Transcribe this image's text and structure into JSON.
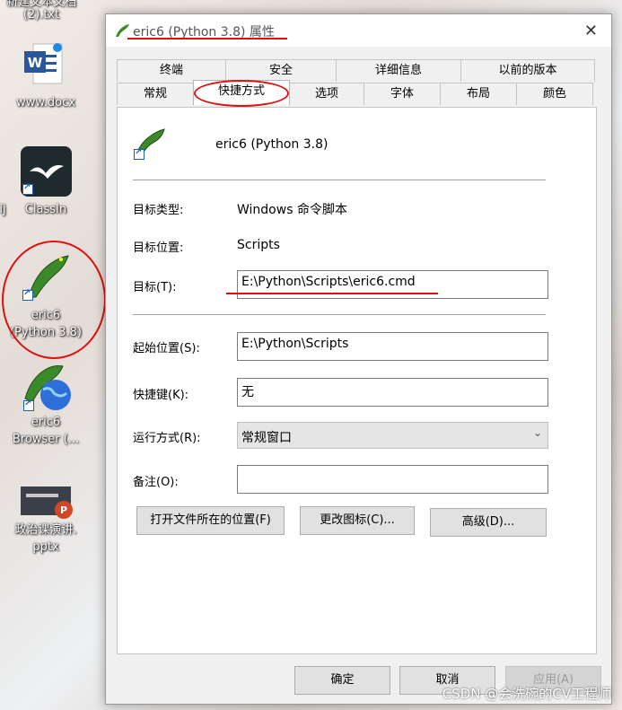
{
  "desktop": {
    "items": [
      {
        "label_line1": "新建文本文档",
        "label_line2": "(2).txt"
      },
      {
        "label_line1": "www.docx",
        "label_line2": ""
      },
      {
        "label_line1": "ClassIn",
        "label_line2": ""
      },
      {
        "label_line1": "eric6",
        "label_line2": "(Python 3.8)"
      },
      {
        "label_line1": "eric6",
        "label_line2": "Browser (..."
      },
      {
        "label_line1": "政治课演讲.",
        "label_line2": "pptx"
      }
    ],
    "left_edge_label": "ij",
    "watermark": "CSDN @会洗碗的CV工程师"
  },
  "dialog": {
    "title": "eric6 (Python 3.8) 属性",
    "close_glyph": "✕",
    "tabs_row1": [
      "终端",
      "安全",
      "详细信息",
      "以前的版本"
    ],
    "tabs_row2": [
      "常规",
      "快捷方式",
      "选项",
      "字体",
      "布局",
      "颜色"
    ],
    "active_tab": "快捷方式",
    "header_name": "eric6 (Python 3.8)",
    "target_type_label": "目标类型:",
    "target_type_value": "Windows 命令脚本",
    "target_location_label": "目标位置:",
    "target_location_value": "Scripts",
    "target_label": "目标(T):",
    "target_value": "E:\\Python\\Scripts\\eric6.cmd",
    "start_in_label": "起始位置(S):",
    "start_in_value": "E:\\Python\\Scripts",
    "shortcut_key_label": "快捷键(K):",
    "shortcut_key_value": "无",
    "run_label": "运行方式(R):",
    "run_value": "常规窗口",
    "comment_label": "备注(O):",
    "comment_value": "",
    "open_location_button": "打开文件所在的位置(F)",
    "change_icon_button": "更改图标(C)...",
    "advanced_button": "高级(D)...",
    "ok_button": "确定",
    "cancel_button": "取消",
    "apply_button": "应用(A)"
  },
  "colors": {
    "annotation_red": "#e01010",
    "snake_green": "#3a8a2a"
  }
}
